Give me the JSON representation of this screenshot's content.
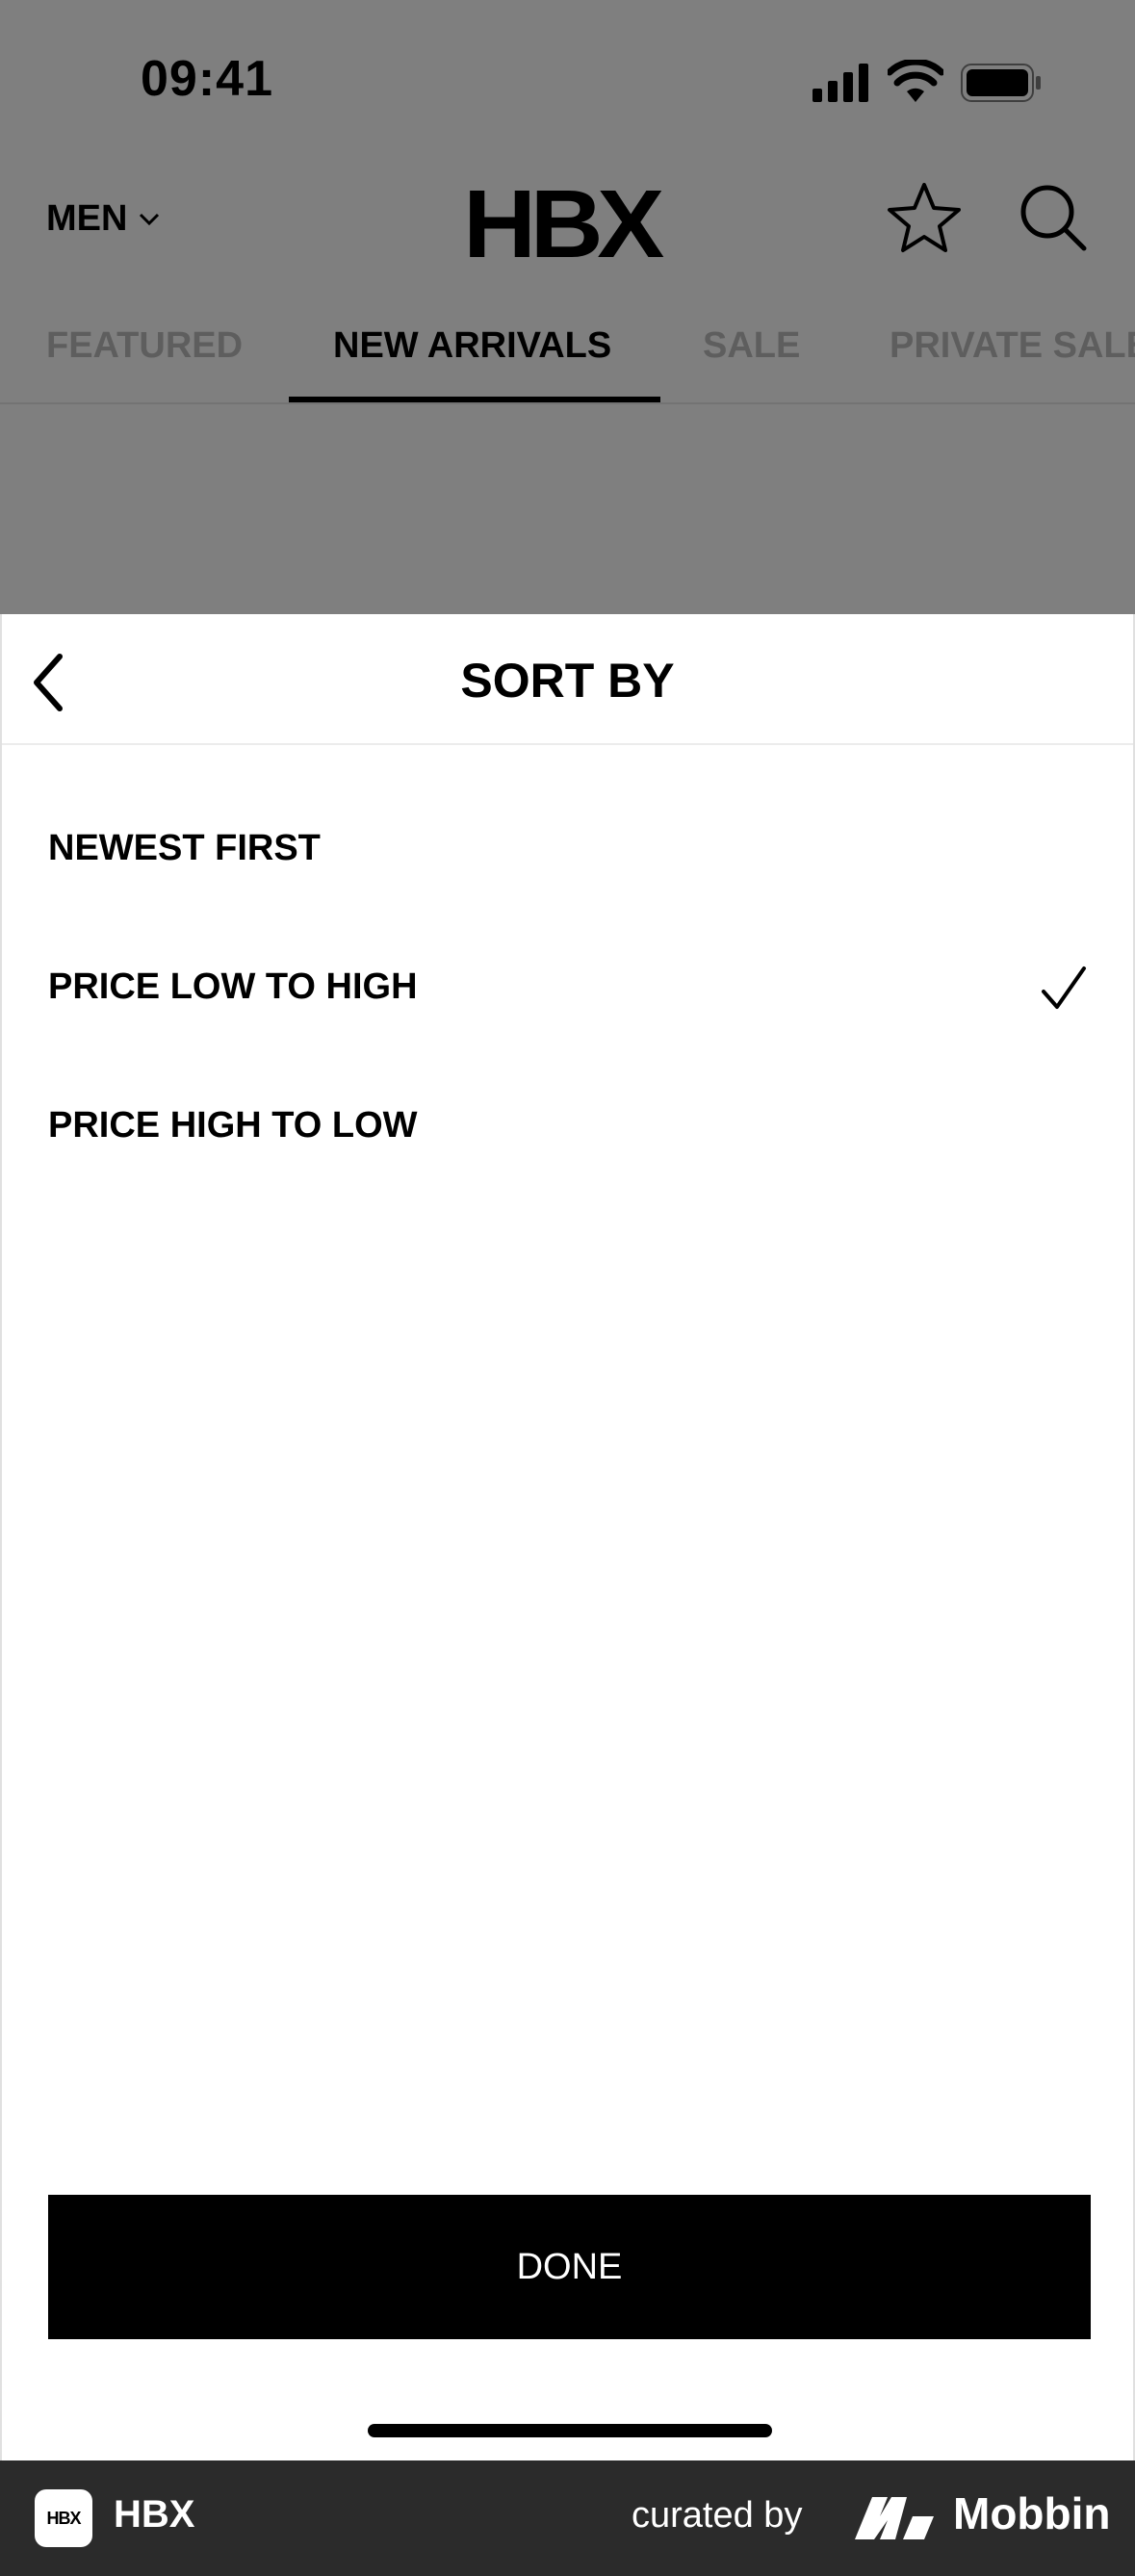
{
  "status_bar": {
    "time": "09:41"
  },
  "header": {
    "gender_label": "MEN",
    "logo": "HBX",
    "icons": [
      "star-icon",
      "search-icon"
    ]
  },
  "tabs": [
    {
      "label": "FEATURED",
      "active": false
    },
    {
      "label": "NEW ARRIVALS",
      "active": true
    },
    {
      "label": "SALE",
      "active": false
    },
    {
      "label": "PRIVATE SALE",
      "active": false
    }
  ],
  "sheet": {
    "title": "SORT BY",
    "options": [
      {
        "label": "NEWEST FIRST",
        "selected": false
      },
      {
        "label": "PRICE LOW TO HIGH",
        "selected": true
      },
      {
        "label": "PRICE HIGH TO LOW",
        "selected": false
      }
    ],
    "done_label": "DONE"
  },
  "footer": {
    "app_icon_text": "HBX",
    "app_name": "HBX",
    "curated_by": "curated by",
    "brand": "Mobbin"
  },
  "colors": {
    "overlay": "#808080",
    "footer_bg": "#2b2b2b",
    "button_bg": "#000000"
  }
}
